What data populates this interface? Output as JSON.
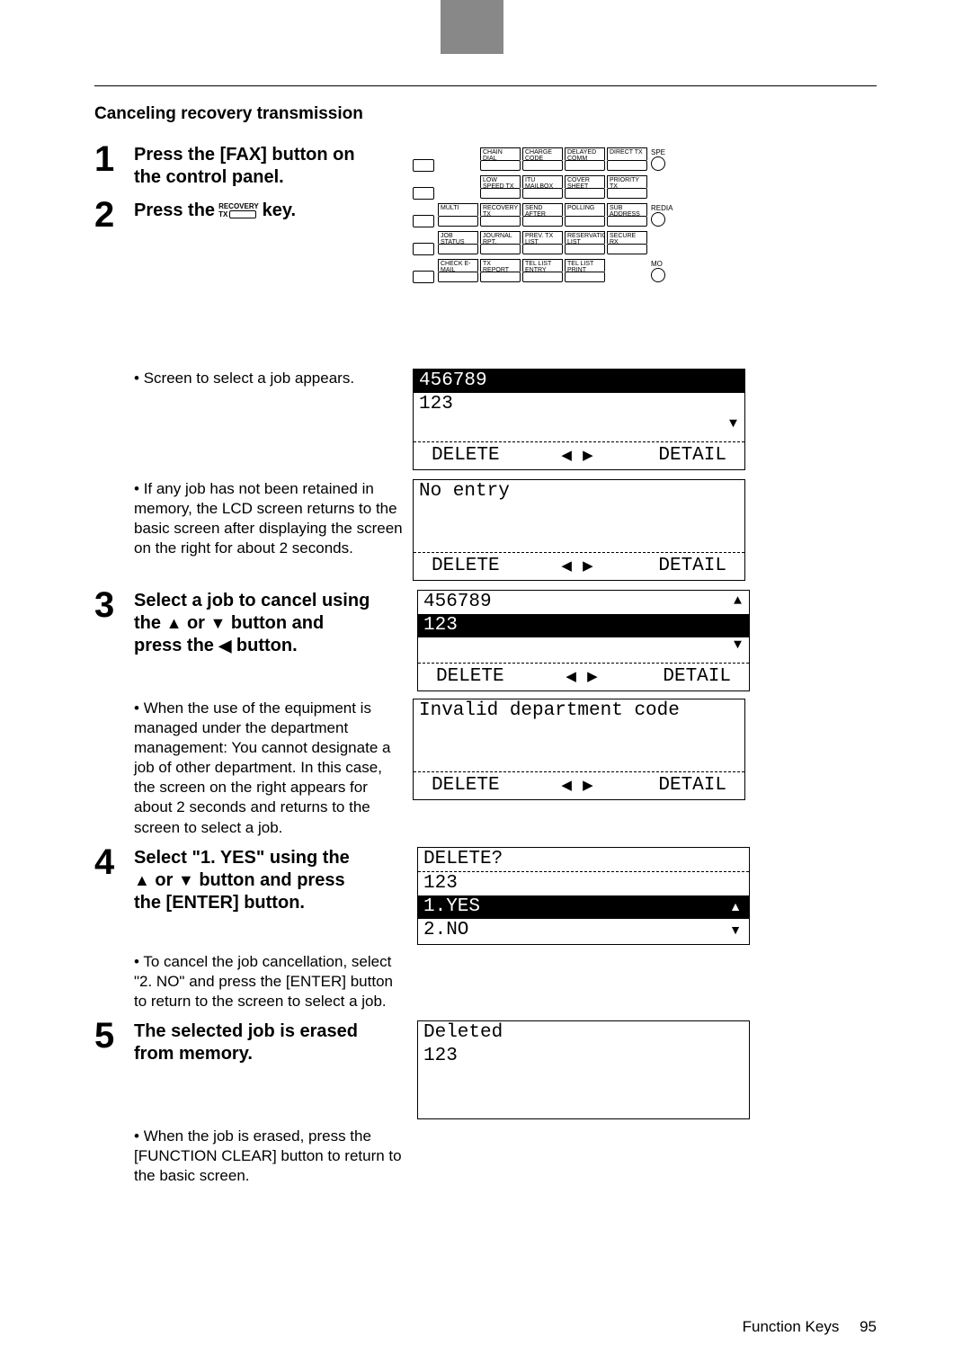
{
  "section_title": "Canceling recovery transmission",
  "steps": {
    "s1": {
      "num": "1",
      "title_a": "Press the [FAX] button on",
      "title_b": "the control panel."
    },
    "s2": {
      "num": "2",
      "title_a": "Press the",
      "title_b": "key.",
      "key_top": "RECOVERY",
      "key_tx": "TX"
    },
    "s3": {
      "num": "3",
      "title_a": "Select a job to cancel using",
      "title_b": "the",
      "title_c": "or",
      "title_d": "button and",
      "title_e": "press the",
      "title_f": "button."
    },
    "s4": {
      "num": "4",
      "title_a": "Select \"1. YES\" using the",
      "title_c": "or",
      "title_d": "button and press",
      "title_e": "the [ENTER] button."
    },
    "s5": {
      "num": "5",
      "title_a": "The selected job is erased",
      "title_b": "from memory."
    }
  },
  "bullets": {
    "b1": "Screen to select a job appears.",
    "b2": "If any job has not been retained in memory, the LCD screen returns to the basic screen after displaying the screen on the right for about 2 seconds.",
    "b3": "When the use of the equipment is managed under the department management: You cannot designate a job of other department. In this case, the screen on the right appears for about 2 seconds and returns to the screen to select a job.",
    "b4": "To cancel the job cancellation, select \"2. NO\" and press the [ENTER] button to return to the screen to select a job.",
    "b5": "When the job is erased, press the [FUNCTION CLEAR] button to return to the basic screen."
  },
  "panel": {
    "rows": [
      [
        {
          "t": "CHAIN DIAL COMM"
        },
        {
          "t": "CHARGE CODE"
        },
        {
          "t": "DELAYED COMM"
        },
        {
          "t": "DIRECT TX"
        }
      ],
      [
        {
          "t": "LOW SPEED TX"
        },
        {
          "t": "ITU MAILBOX"
        },
        {
          "t": "COVER SHEET"
        },
        {
          "t": "PRIORITY TX"
        }
      ],
      [
        {
          "t": "MULTI"
        },
        {
          "t": "RECOVERY TX"
        },
        {
          "t": "SEND AFTER SCAN"
        },
        {
          "t": "POLLING"
        },
        {
          "t": "SUB ADDRESS COMM"
        }
      ],
      [
        {
          "t": "JOB STATUS"
        },
        {
          "t": "JOURNAL RPT."
        },
        {
          "t": "PREV. TX LIST"
        },
        {
          "t": "RESERVATION LIST"
        },
        {
          "t": "SECURE RX"
        }
      ],
      [
        {
          "t": "CHECK E-MAIL"
        },
        {
          "t": "TX REPORT"
        },
        {
          "t": "TEL LIST ENTRY"
        },
        {
          "t": "TEL LIST PRINT"
        }
      ]
    ],
    "side_labels": [
      "",
      "SPE",
      "",
      "REDIA",
      "",
      "MO"
    ],
    "side_icons": [
      false,
      true,
      false,
      true,
      false,
      true
    ]
  },
  "lcd": {
    "job1": "456789",
    "job2": "123",
    "delete": "DELETE",
    "detail": "DETAIL",
    "no_entry": "No entry",
    "invalid": "Invalid department code",
    "delete_q": "DELETE?",
    "yes": "1.YES",
    "no": "2.NO",
    "deleted": "Deleted"
  },
  "footer": {
    "section": "Function Keys",
    "page": "95"
  }
}
